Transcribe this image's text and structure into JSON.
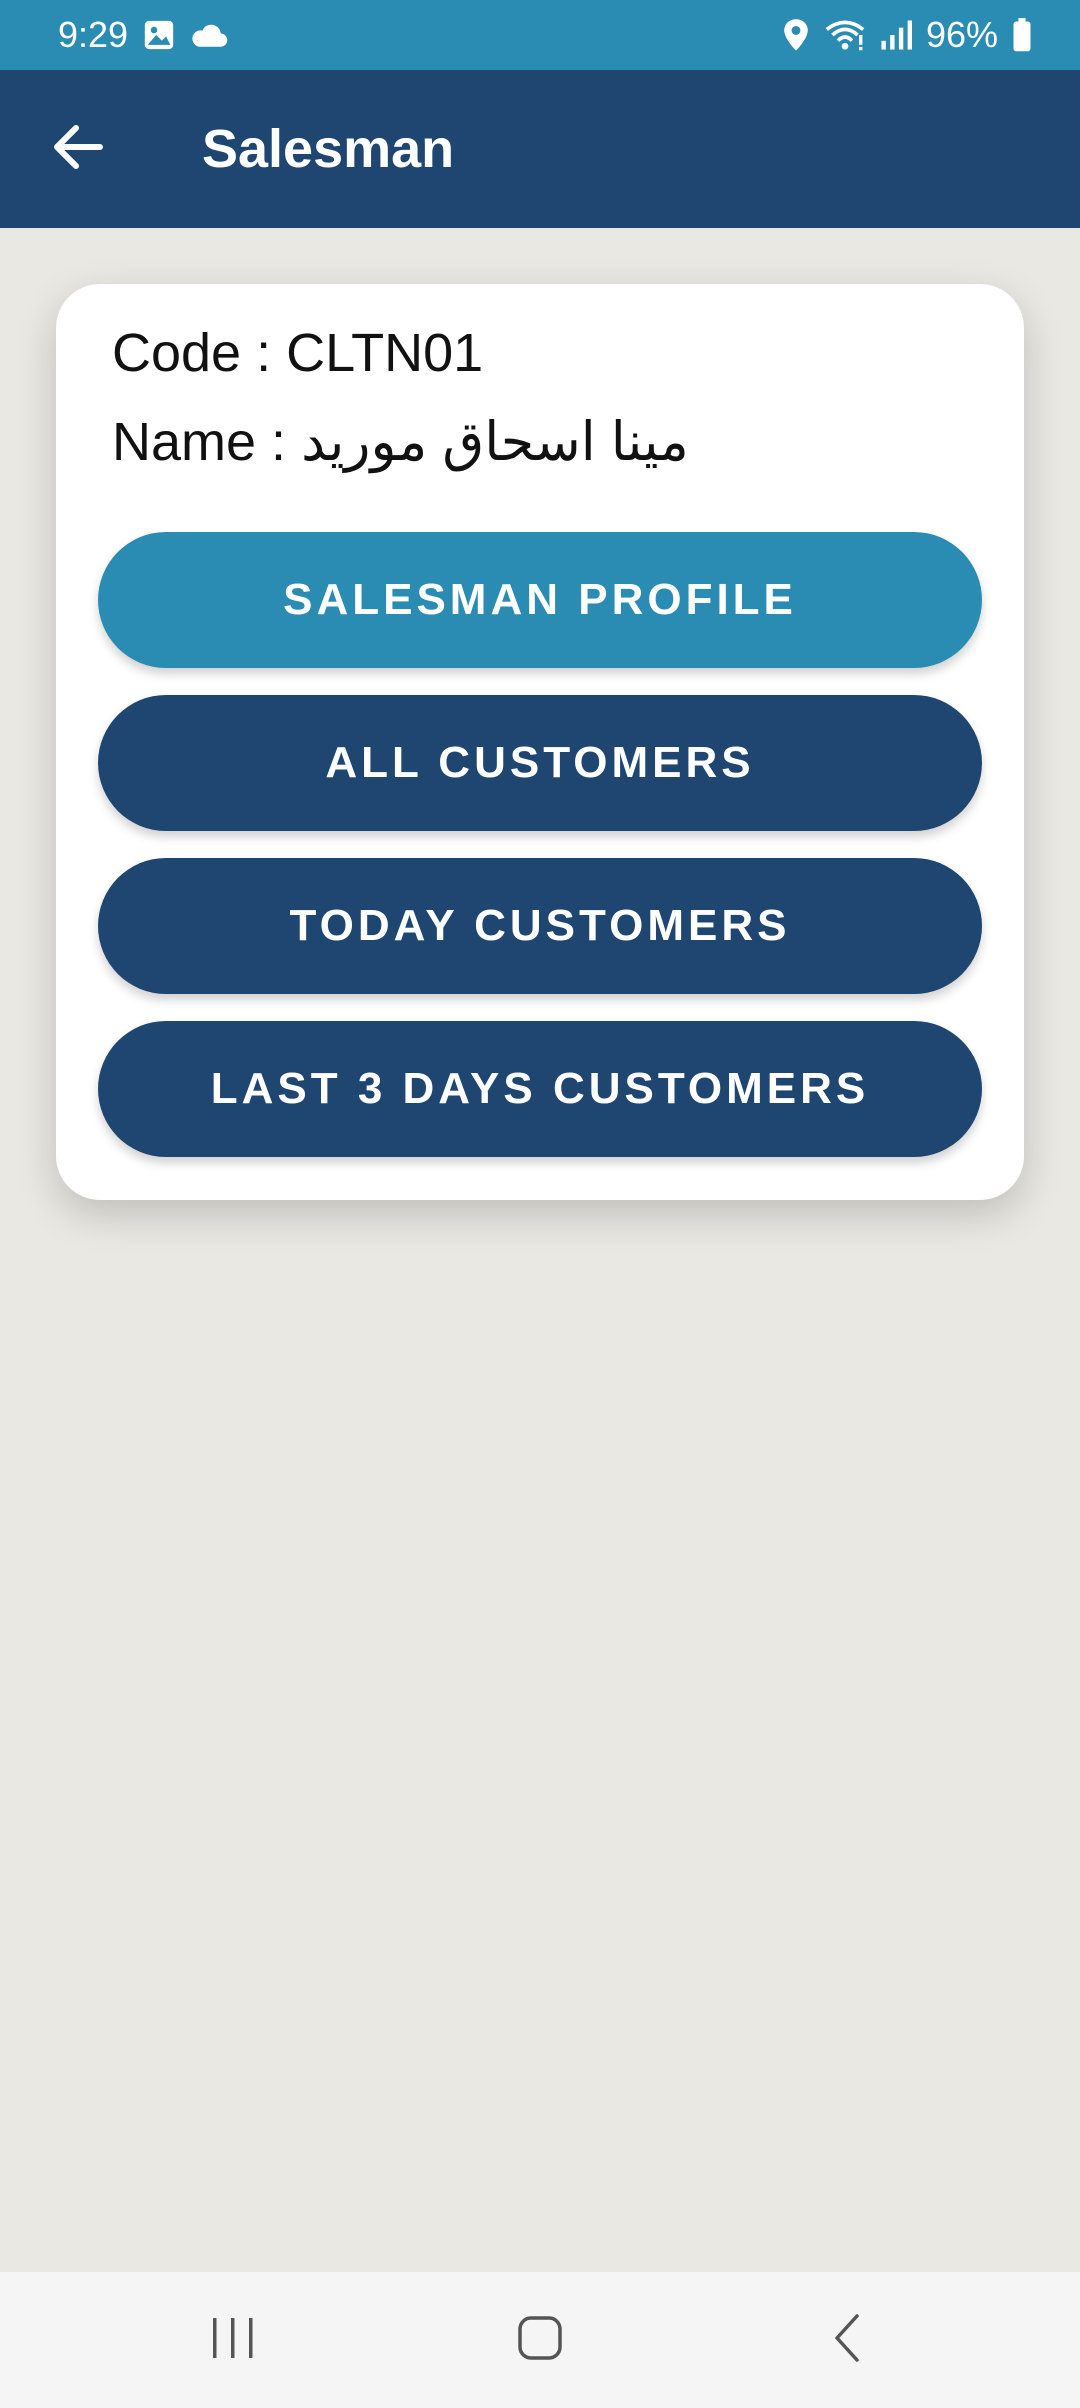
{
  "status_bar": {
    "time": "9:29",
    "battery": "96%",
    "icons_left": [
      "image-icon",
      "cloud-icon"
    ],
    "icons_right": [
      "location-icon",
      "wifi-icon",
      "signal-icon",
      "battery-icon"
    ]
  },
  "app_bar": {
    "title": "Salesman",
    "back_icon": "arrow-left-icon"
  },
  "card": {
    "code_label": "Code : ",
    "code_value": "CLTN01",
    "name_label": "Name : ",
    "name_value": "مينا اسحاق موريد",
    "buttons": [
      {
        "label": "SALESMAN PROFILE",
        "color": "#2A8CB3"
      },
      {
        "label": "ALL CUSTOMERS",
        "color": "#1E4670"
      },
      {
        "label": "TODAY CUSTOMERS",
        "color": "#1E4670"
      },
      {
        "label": "LAST 3 DAYS CUSTOMERS",
        "color": "#1E4670"
      }
    ]
  },
  "nav_bar": {
    "items": [
      "recents-icon",
      "home-icon",
      "back-icon"
    ]
  },
  "colors": {
    "status_bar": "#2A8CB3",
    "app_bar": "#1E4670",
    "background": "#E9E8E2",
    "card": "#FFFFFF"
  }
}
